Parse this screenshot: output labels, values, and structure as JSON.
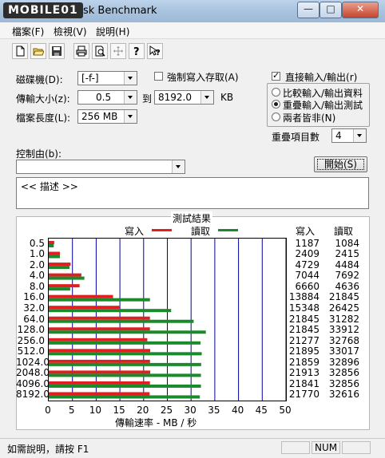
{
  "window": {
    "logo_text": "MOBILE01",
    "title": "sk Benchmark",
    "minimize": "—",
    "maximize": "□",
    "close": "✕"
  },
  "menu": [
    "檔案(F)",
    "檢視(V)",
    "說明(H)"
  ],
  "toolbar": [
    "new-icon",
    "open-icon",
    "save-icon",
    "print-icon",
    "print-preview-icon",
    "move-icon",
    "help-icon",
    "context-help-icon"
  ],
  "settings": {
    "drive_label": "磁碟機(D):",
    "drive_value": "[-f-]",
    "size_label": "傳輸大小(z):",
    "size_from": "0.5",
    "size_to_label": "到",
    "size_to": "8192.0",
    "size_unit": "KB",
    "length_label": "檔案長度(L):",
    "length_value": "256 MB",
    "force_write_label": "強制寫入存取(A)",
    "force_write_checked": false,
    "direct_io_label": "直接輸入/輸出(r)",
    "direct_io_checked": true,
    "modes": [
      {
        "label": "比較輸入/輸出資料",
        "selected": false
      },
      {
        "label": "重疊輸入/輸出測試",
        "selected": true
      },
      {
        "label": "兩者皆非(N)",
        "selected": false
      }
    ],
    "queue_label": "重疊項目數",
    "queue_value": "4",
    "controlled_by_label": "控制由(b):",
    "controlled_by_value": "",
    "start_button": "開始(S)",
    "description": "<<    描述    >>"
  },
  "results": {
    "title": "測試結果",
    "legend_write": "寫入",
    "legend_read": "讀取",
    "col_write": "寫入",
    "col_read": "讀取",
    "write_color": "#e02020",
    "read_color": "#1a8a2a"
  },
  "chart_data": {
    "type": "bar",
    "orientation": "horizontal",
    "categories": [
      "0.5",
      "1.0",
      "2.0",
      "4.0",
      "8.0",
      "16.0",
      "32.0",
      "64.0",
      "128.0",
      "256.0",
      "512.0",
      "1024.0",
      "2048.0",
      "4096.0",
      "8192.0"
    ],
    "series": [
      {
        "name": "寫入",
        "values": [
          1187,
          2409,
          4729,
          7044,
          6660,
          13884,
          15348,
          21845,
          21845,
          21277,
          21895,
          21859,
          21913,
          21841,
          21770
        ]
      },
      {
        "name": "讀取",
        "values": [
          1084,
          2415,
          4484,
          7692,
          4636,
          21845,
          26425,
          31282,
          33912,
          32768,
          33017,
          32896,
          32856,
          32856,
          32616
        ]
      }
    ],
    "xlabel": "傳輸速率 - MB / 秒",
    "xticks": [
      "0",
      "5",
      "10",
      "15",
      "20",
      "25",
      "30",
      "35",
      "40",
      "45",
      "50"
    ],
    "xlim": [
      0,
      50
    ],
    "grid": true
  },
  "status": {
    "help_text": "如需說明，請按 F1",
    "num": "NUM"
  }
}
